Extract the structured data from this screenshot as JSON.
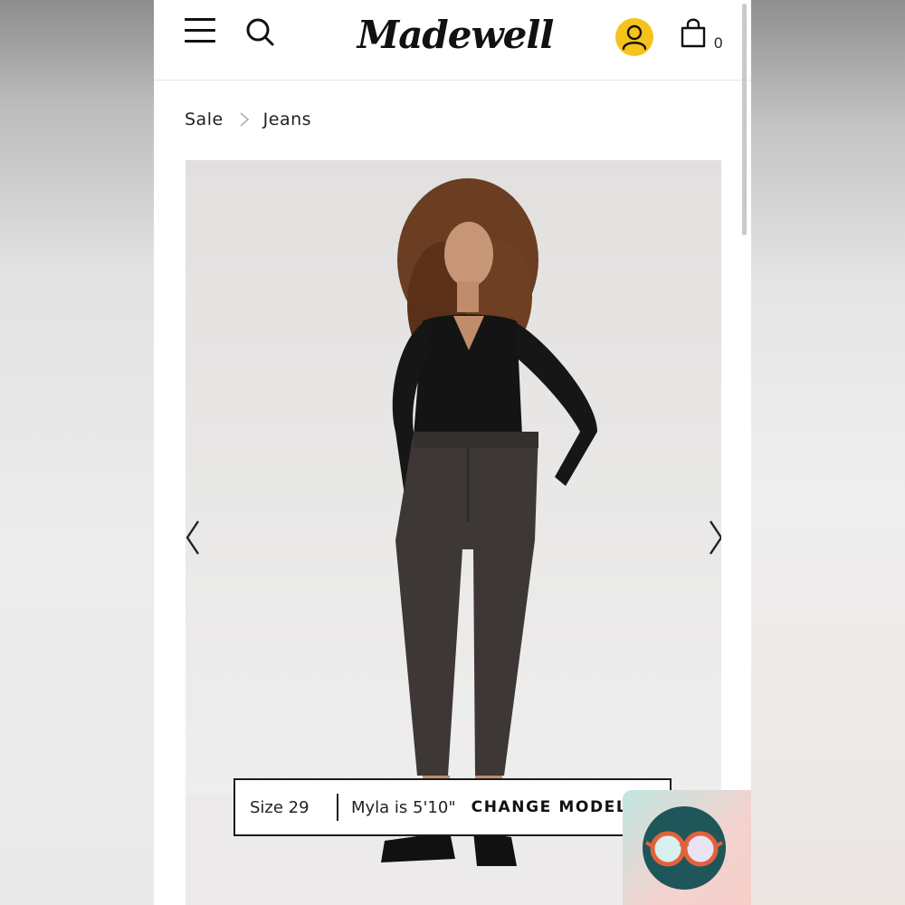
{
  "brand": {
    "logo_text": "Madewell",
    "accent_color": "#f5c31b"
  },
  "header": {
    "menu_icon": "hamburger-menu-icon",
    "search_icon": "search-icon",
    "account_icon": "user-account-icon",
    "bag_icon": "shopping-bag-icon",
    "bag_count": "0"
  },
  "breadcrumb": {
    "items": [
      "Sale",
      "Jeans"
    ],
    "separator_icon": "chevron-right-icon"
  },
  "product_gallery": {
    "image": "model-wearing-dark-high-rise-jeans-and-black-top",
    "prev_icon": "chevron-left-icon",
    "next_icon": "chevron-right-icon"
  },
  "model_info": {
    "size": "Size 29",
    "height": "Myla is 5'10\"",
    "change_model": "CHANGE MODEL"
  },
  "assistant": {
    "icon": "glasses-icon",
    "color": "#1f5659"
  }
}
